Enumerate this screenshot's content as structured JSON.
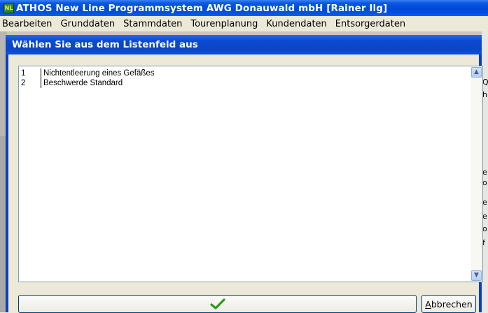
{
  "app": {
    "icon_text": "NL",
    "title": "ATHOS New Line Programmsystem AWG Donauwald mbH  [Rainer Ilg]"
  },
  "menu": {
    "items": [
      "Bearbeiten",
      "Grunddaten",
      "Stammdaten",
      "Tourenplanung",
      "Kundendaten",
      "Entsorgerdaten"
    ]
  },
  "background_fragments": [
    "Q",
    "h",
    "e",
    "o",
    "e",
    "e",
    "o",
    "f"
  ],
  "dialog": {
    "title": "Wählen Sie aus dem Listenfeld aus",
    "list": {
      "rows": [
        {
          "num": "1",
          "text": "Nichtentleerung eines Gefäßes"
        },
        {
          "num": "2",
          "text": "Beschwerde Standard"
        }
      ]
    },
    "ok_icon": "checkmark-icon",
    "cancel_label_underlined": "A",
    "cancel_label_rest": "bbrechen"
  },
  "colors": {
    "title_bar": "#0049d8",
    "dialog_frame": "#0a3fbf",
    "window_bg": "#ece9d8",
    "check": "#2c9a1c"
  }
}
